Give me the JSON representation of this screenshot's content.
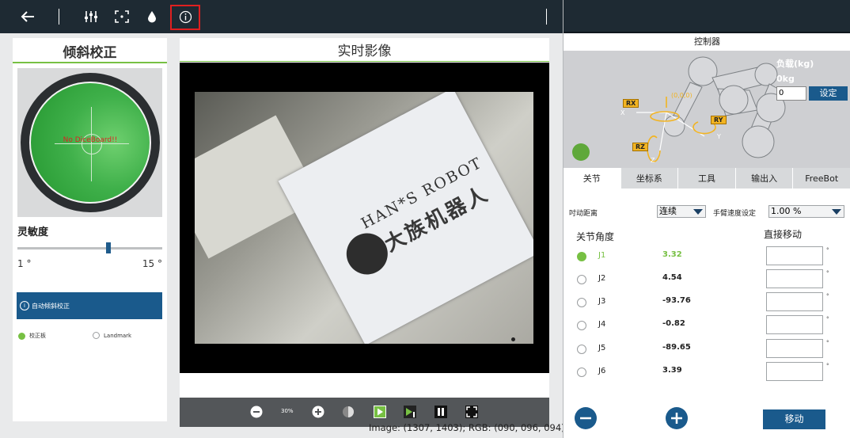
{
  "toolbar": {
    "icons": [
      "back-arrow-icon",
      "sliders-icon",
      "focus-frame-icon",
      "drop-icon",
      "info-icon"
    ],
    "highlight_color": "#e02020"
  },
  "left_panel": {
    "title": "倾斜校正",
    "tilt_status": "No DiceBoard!!",
    "sensitivity_label": "灵敏度",
    "slider_min": "1 °",
    "slider_max": "15 °",
    "slider_level_fraction": 0.63,
    "auto_button": "自动倾斜校正",
    "options": [
      "校正板",
      "Landmark"
    ],
    "selected_option": 0
  },
  "center_panel": {
    "title": "实时影像",
    "camera_text_1": "HAN*S ROBOT",
    "camera_text_2": "大族机器人",
    "zoom": "30%"
  },
  "status_bar": {
    "text": "Image: (1307, 1403); RGB: (090, 096, 094);"
  },
  "right_panel": {
    "title": "控制器",
    "load_label": "负载(kg)",
    "load_value": "0kg",
    "load_input": "0",
    "set_button": "设定",
    "axes": {
      "rx": "RX",
      "ry": "RY",
      "rz": "RZ",
      "x": "X",
      "y": "Y",
      "z": "Z",
      "origin": "(0,0,0)"
    },
    "tabs": [
      "关节",
      "坐标系",
      "工具",
      "输出入",
      "FreeBot"
    ],
    "active_tab": 0,
    "jog_distance_label": "吋动距离",
    "jog_distance_value": "连续",
    "arm_speed_label": "手臂速度设定",
    "arm_speed_value": "1.00 %",
    "joint_angle_label": "关节角度",
    "direct_move_label": "直接移动",
    "joints": [
      {
        "name": "J1",
        "value": "3.32",
        "selected": true
      },
      {
        "name": "J2",
        "value": "4.54",
        "selected": false
      },
      {
        "name": "J3",
        "value": "-93.76",
        "selected": false
      },
      {
        "name": "J4",
        "value": "-0.82",
        "selected": false
      },
      {
        "name": "J5",
        "value": "-89.65",
        "selected": false
      },
      {
        "name": "J6",
        "value": "3.39",
        "selected": false
      }
    ],
    "degree_unit": "°",
    "move_button": "移动"
  },
  "colors": {
    "accent_green": "#77c043",
    "primary_blue": "#1a5a8c",
    "dark_bar": "#1e2a33"
  }
}
